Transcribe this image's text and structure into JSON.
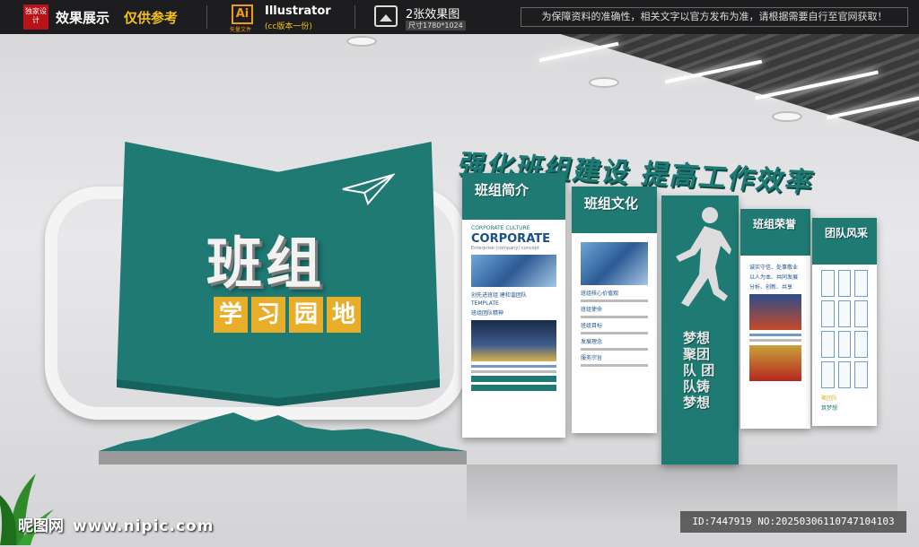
{
  "banner": {
    "badge": "独家设计",
    "label_a": "效果展示",
    "label_b": "仅供参考",
    "ai_icon": "Ai",
    "ai_sub": "矢量文件",
    "software": "Illustrator",
    "version": "(cc版本一份)",
    "count": "2张效果图",
    "size": "尺寸1780*1024",
    "notice": "为保障资料的准确性，相关文字以官方发布为准，请根据需要自行至官网获取！"
  },
  "book": {
    "title": "班组",
    "subtitle_chars": [
      "学",
      "习",
      "园",
      "地"
    ]
  },
  "slogan": "强化班组建设 提高工作效率",
  "panels": [
    {
      "title": "班组简介",
      "sub": "CORPORATE CULTURE",
      "big": "CORPORATE",
      "small": "Enterprise (company) concept",
      "items": [
        "创先进班组 建和谐团队",
        "TEMPLATE",
        "班组团队精神"
      ]
    },
    {
      "title": "班组文化",
      "items": [
        "班组核心价值观",
        "班组使命",
        "班组目标",
        "发展理念",
        "服务宗旨"
      ]
    },
    {
      "title": "班组荣誉",
      "items": [
        "诚实守信、处事敬业",
        "以人为本、共同发展",
        "分析、创新、共享"
      ]
    },
    {
      "title": "团队风采",
      "footer": [
        "聚团队",
        "筑梦想"
      ]
    }
  ],
  "runner_text": "梦想聚团队 团队铸梦想",
  "watermark": {
    "site": "昵图网",
    "url": "www.nipic.com"
  },
  "id_text": "ID:7447919 NO:20250306110747104103",
  "colors": {
    "teal": "#1f7a73",
    "gold": "#e8ae2a",
    "wall": "#e0e0e2"
  }
}
